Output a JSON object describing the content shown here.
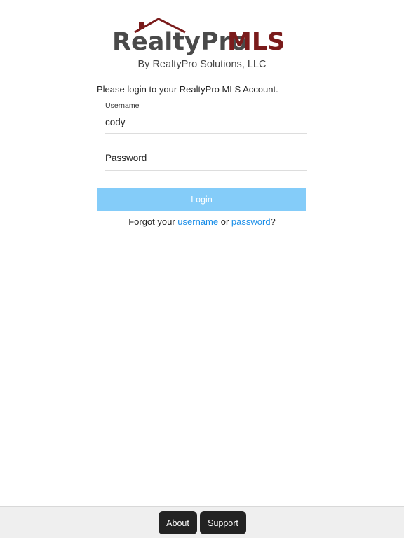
{
  "brand": {
    "logo_text_part1": "RealtyPro",
    "logo_text_part2": "MLS",
    "subtitle": "By RealtyPro Solutions, LLC",
    "colors": {
      "dark_gray": "#4a4a4a",
      "maroon": "#7a1b1b"
    }
  },
  "login_form": {
    "prompt": "Please login to your RealtyPro MLS Account.",
    "username": {
      "label": "Username",
      "value": "cody"
    },
    "password": {
      "placeholder": "Password"
    },
    "login_button_label": "Login",
    "login_button_color": "#84ccf9"
  },
  "forgot": {
    "prefix": "Forgot your ",
    "username_link": "username",
    "middle": " or ",
    "password_link": "password",
    "suffix": "?",
    "link_color": "#1a8ee8"
  },
  "footer": {
    "about_label": "About",
    "support_label": "Support"
  }
}
